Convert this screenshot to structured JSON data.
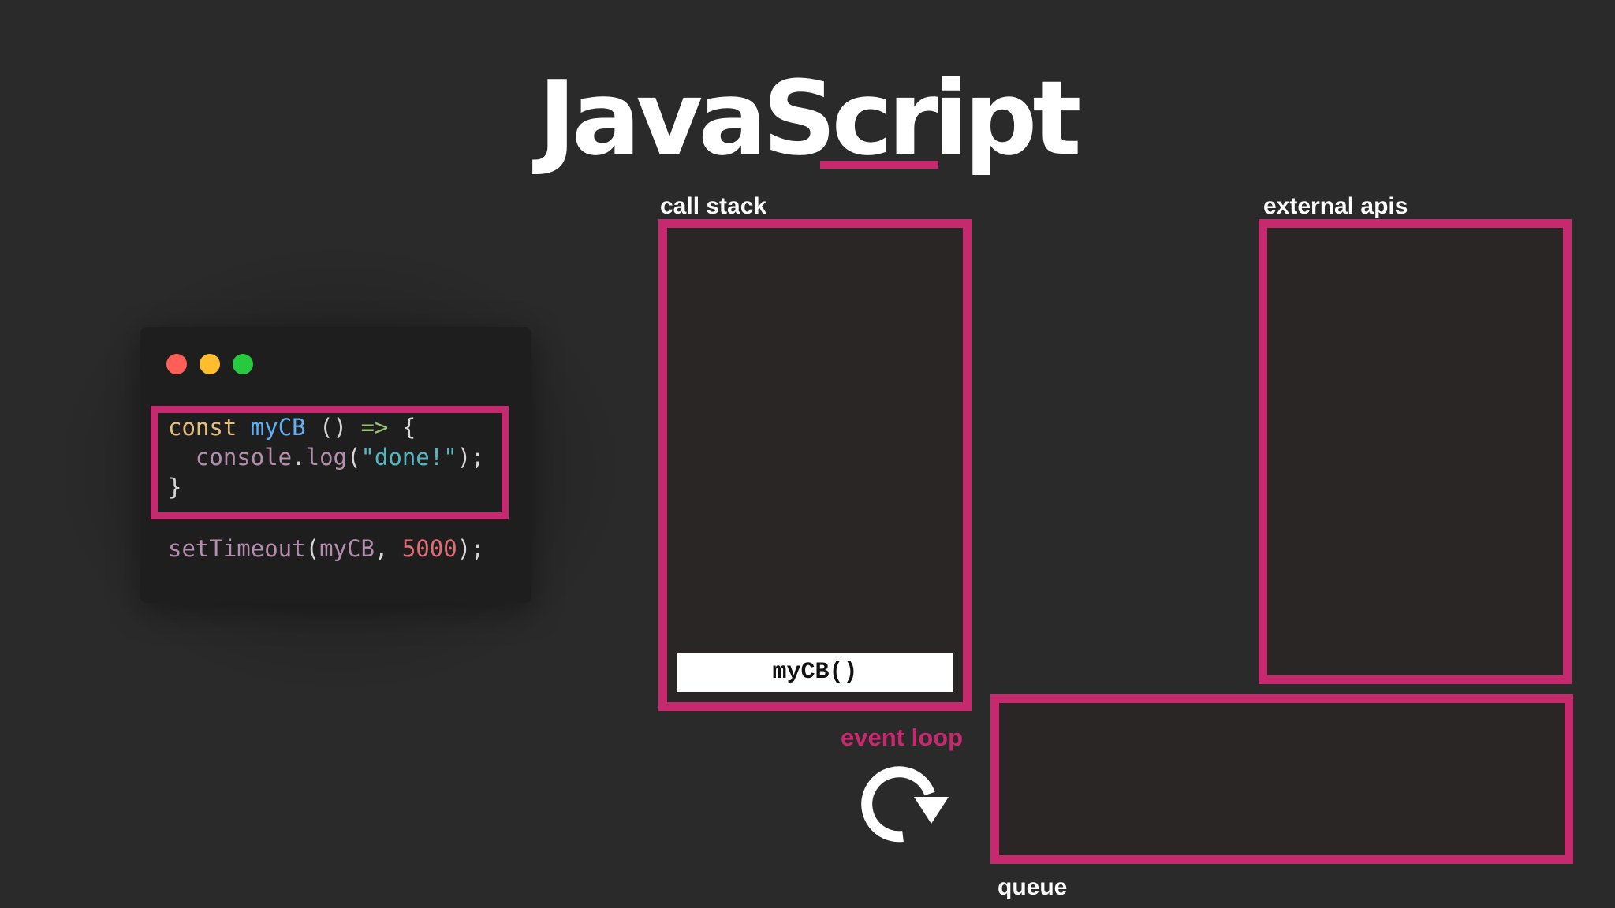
{
  "title": "JavaScript",
  "colors": {
    "background": "#2b2a2a",
    "accent": "#c7296f",
    "text": "#ffffff",
    "code_background": "#1e1e1f"
  },
  "code_window": {
    "window_controls": [
      "red-dot",
      "yellow-dot",
      "green-dot"
    ],
    "line1": {
      "keyword": "const",
      "name": "myCB",
      "rest": " () ",
      "arrow": "=>",
      "brace": " {"
    },
    "line2": {
      "indent": "  ",
      "object": "console",
      "dot": ".",
      "method": "log",
      "open": "(",
      "string": "\"done!\"",
      "close": ");"
    },
    "line3": {
      "brace": "}"
    },
    "line4": {
      "fn": "setTimeout",
      "open": "(",
      "arg": "myCB",
      "comma": ", ",
      "number": "5000",
      "close": ");"
    }
  },
  "call_stack": {
    "label": "call stack",
    "frames": [
      "myCB()"
    ]
  },
  "external_apis": {
    "label": "external apis"
  },
  "event_loop": {
    "label": "event loop",
    "icon": "rotate-clockwise-icon"
  },
  "queue": {
    "label": "queue"
  }
}
